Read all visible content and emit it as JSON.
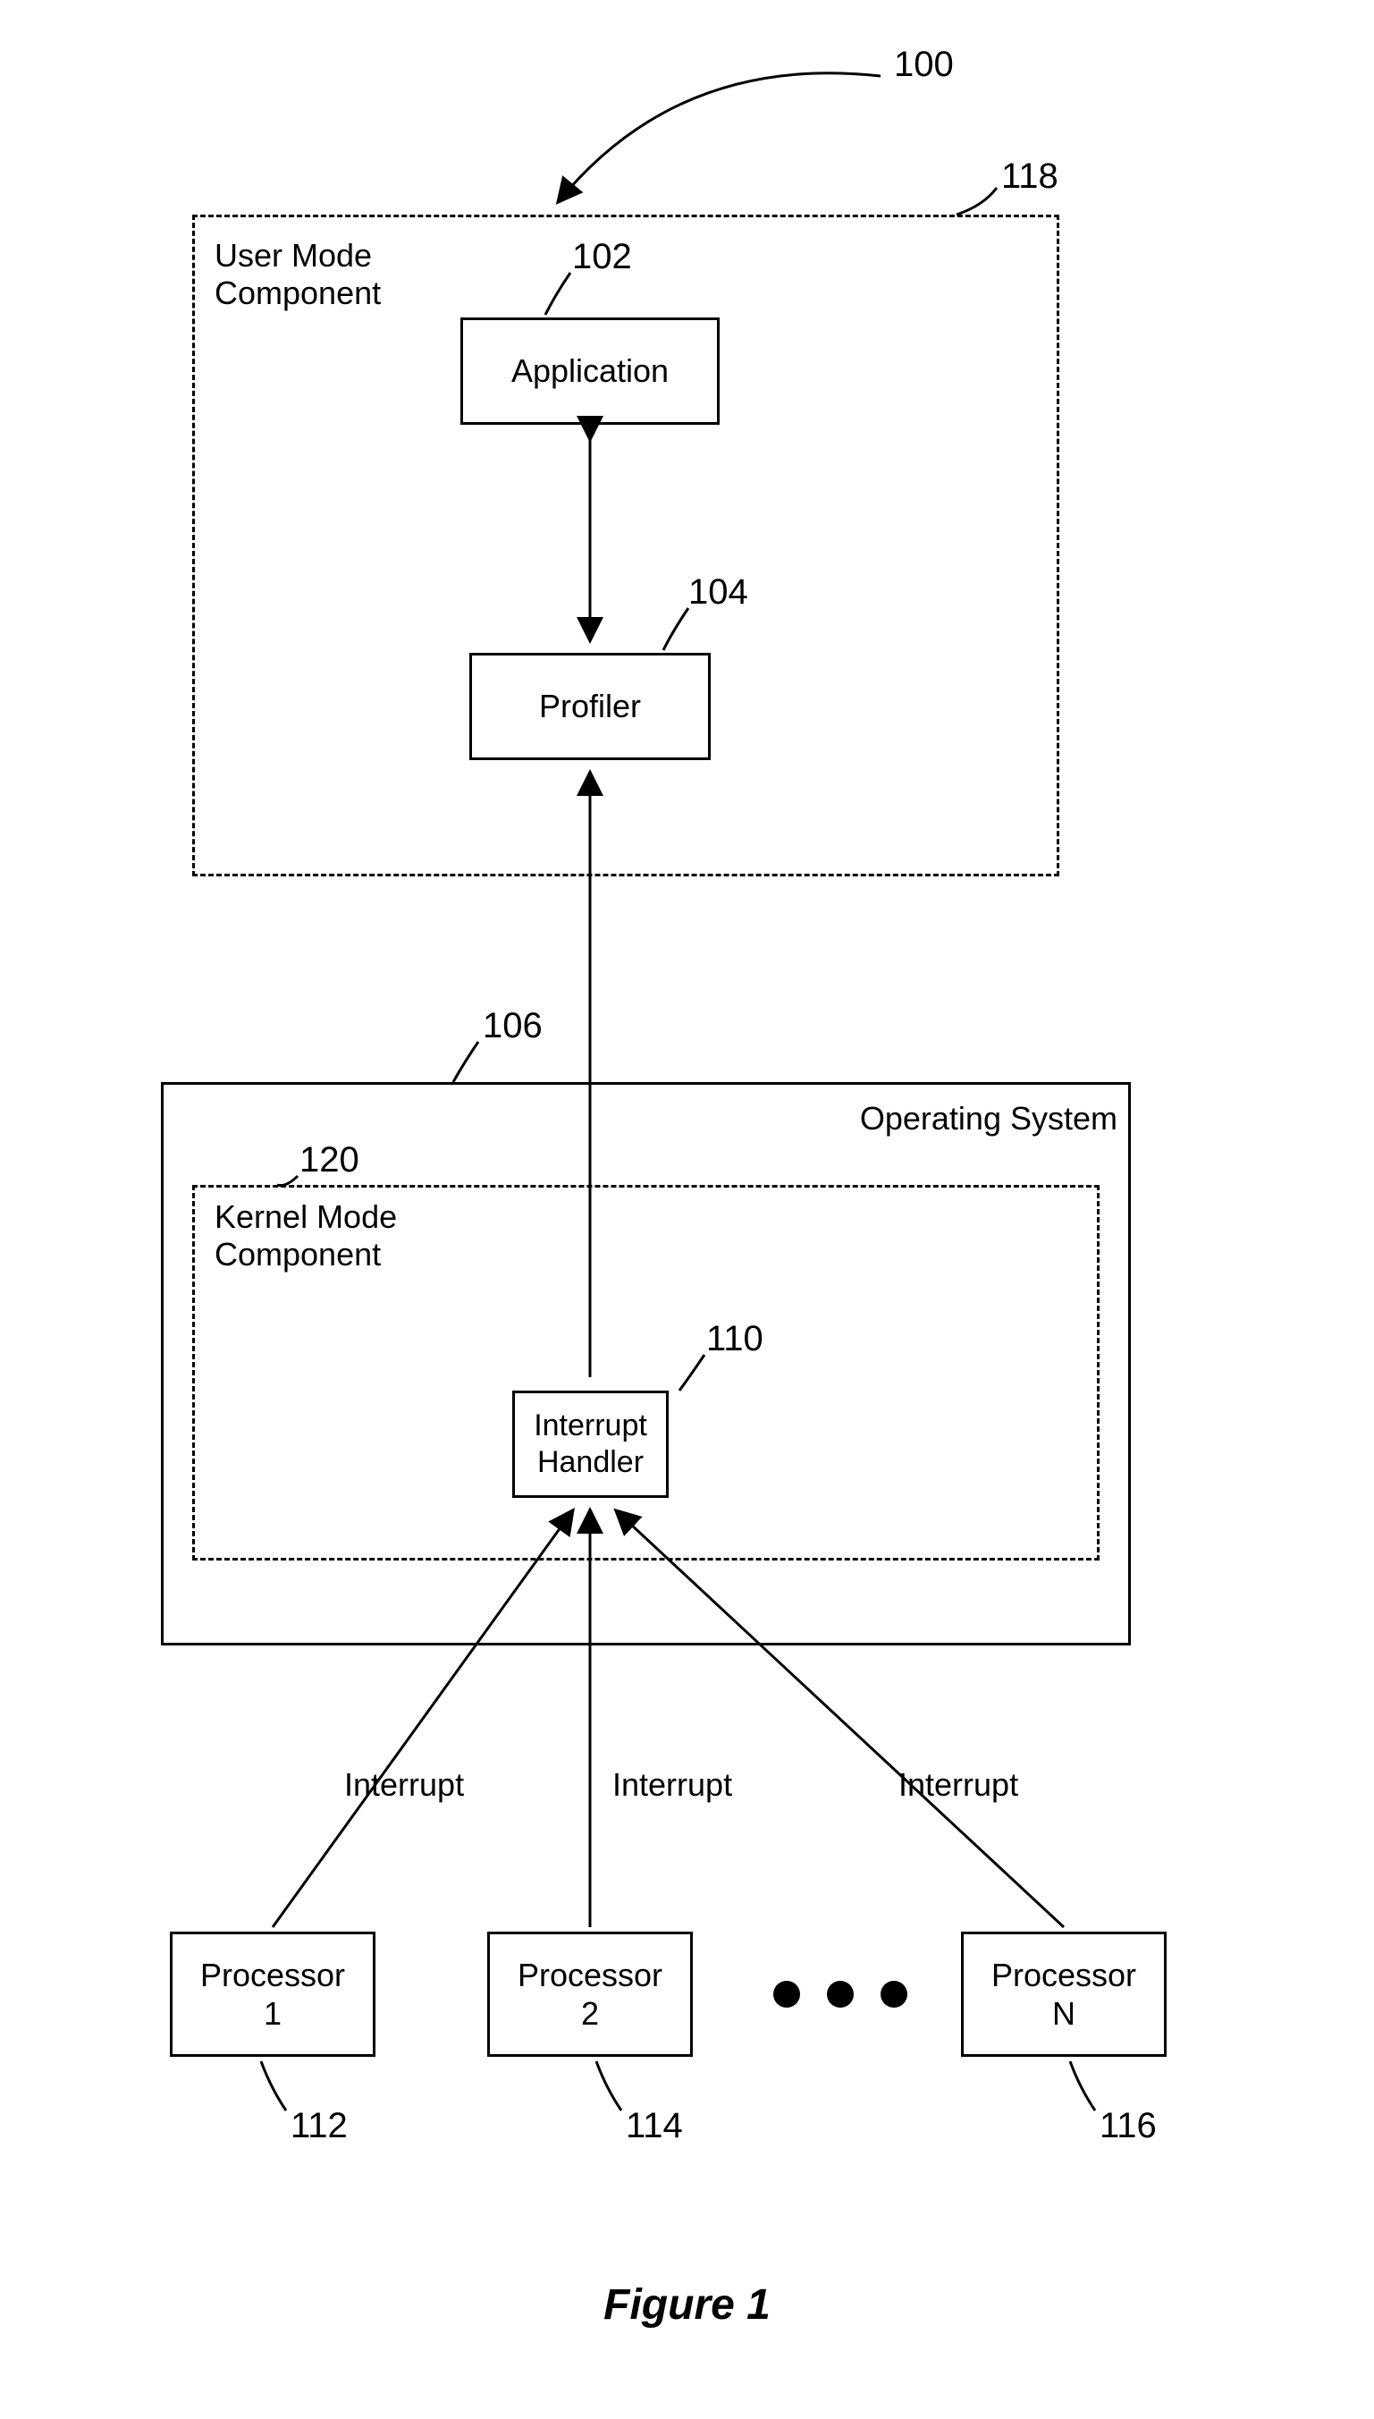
{
  "refs": {
    "r100": "100",
    "r118": "118",
    "r102": "102",
    "r104": "104",
    "r106": "106",
    "r120": "120",
    "r110": "110",
    "r112": "112",
    "r114": "114",
    "r116": "116"
  },
  "blocks": {
    "user_mode": "User Mode\nComponent",
    "application": "Application",
    "profiler": "Profiler",
    "operating_system": "Operating System",
    "kernel_mode": "Kernel Mode\nComponent",
    "interrupt_handler": "Interrupt\nHandler",
    "processor1": "Processor\n1",
    "processor2": "Processor\n2",
    "processorN": "Processor\nN"
  },
  "labels": {
    "interrupt": "Interrupt"
  },
  "figure": "Figure 1",
  "chart_data": {
    "type": "diagram",
    "title": "Figure 1",
    "nodes": [
      {
        "id": "100",
        "label": "(diagram reference)"
      },
      {
        "id": "118",
        "label": "User Mode Component (container)"
      },
      {
        "id": "102",
        "label": "Application"
      },
      {
        "id": "104",
        "label": "Profiler"
      },
      {
        "id": "106",
        "label": "Operating System (container)"
      },
      {
        "id": "120",
        "label": "Kernel Mode Component (container)"
      },
      {
        "id": "110",
        "label": "Interrupt Handler"
      },
      {
        "id": "112",
        "label": "Processor 1"
      },
      {
        "id": "114",
        "label": "Processor 2"
      },
      {
        "id": "116",
        "label": "Processor N"
      }
    ],
    "edges": [
      {
        "from": "102",
        "to": "104",
        "label": "",
        "bidirectional": true
      },
      {
        "from": "110",
        "to": "104",
        "label": "",
        "bidirectional": false
      },
      {
        "from": "112",
        "to": "110",
        "label": "Interrupt",
        "bidirectional": false
      },
      {
        "from": "114",
        "to": "110",
        "label": "Interrupt",
        "bidirectional": false
      },
      {
        "from": "116",
        "to": "110",
        "label": "Interrupt",
        "bidirectional": false
      }
    ],
    "containment": [
      {
        "parent": "118",
        "children": [
          "102",
          "104"
        ]
      },
      {
        "parent": "106",
        "children": [
          "120"
        ]
      },
      {
        "parent": "120",
        "children": [
          "110"
        ]
      }
    ],
    "notes": "Ellipsis (…) between Processor 2 and Processor N indicating multiple processors."
  }
}
